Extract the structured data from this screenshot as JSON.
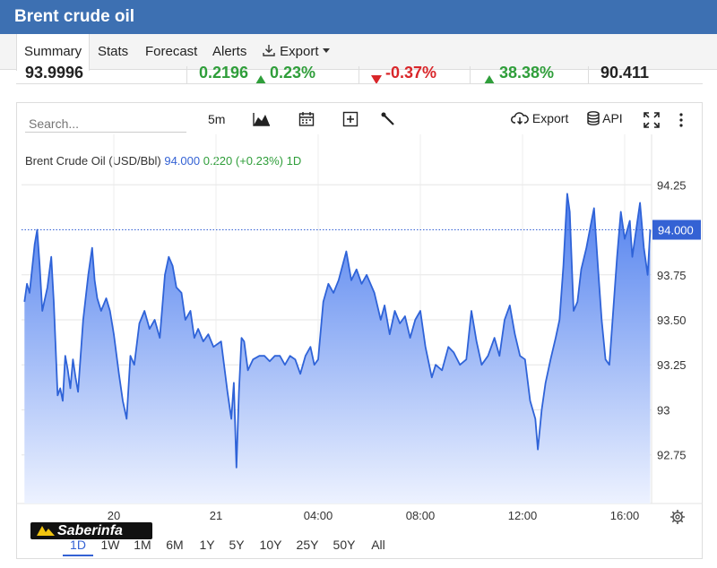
{
  "app": {
    "title": "Brent crude oil"
  },
  "tabs": [
    {
      "label": "Summary",
      "active": true
    },
    {
      "label": "Stats",
      "active": false
    },
    {
      "label": "Forecast",
      "active": false
    },
    {
      "label": "Alerts",
      "active": false
    },
    {
      "label": "Export",
      "active": false
    }
  ],
  "quote_strip": [
    "93.9996",
    "0.2196",
    "0.23%",
    "-0.37%",
    "38.38%",
    "90.411"
  ],
  "toolbar": {
    "search_placeholder": "Search...",
    "interval": "5m",
    "export_label": "Export",
    "api_label": "API"
  },
  "legend": {
    "name": "Brent Crude Oil (USD/Bbl)",
    "price": "94.000",
    "change": "0.220 (+0.23%)",
    "period": "1D"
  },
  "range_buttons": [
    "1D",
    "1W",
    "1M",
    "6M",
    "1Y",
    "5Y",
    "10Y",
    "25Y",
    "50Y",
    "All"
  ],
  "active_range": "1D",
  "watermark": {
    "text": "Saberinfa"
  },
  "colors": {
    "header_bg": "#3d70b2",
    "line": "#2f63d8",
    "area_top": "#4f7fee",
    "area_bottom": "#edf2ff",
    "price_tag": "#3462d4",
    "positive": "#2f9e3a",
    "negative": "#d9262a"
  },
  "chart_data": {
    "type": "area",
    "title": "Brent Crude Oil (USD/Bbl)",
    "ylim": [
      92.48,
      94.53
    ],
    "y_ticks": [
      {
        "value": 92.75,
        "label": "92.75"
      },
      {
        "value": 93.0,
        "label": "93"
      },
      {
        "value": 93.25,
        "label": "93.25"
      },
      {
        "value": 93.5,
        "label": "93.50"
      },
      {
        "value": 93.75,
        "label": "93.75"
      },
      {
        "value": 94.25,
        "label": "94.25"
      }
    ],
    "x_ticks": [
      {
        "label": "20",
        "hour": -4
      },
      {
        "label": "21",
        "hour": 0
      },
      {
        "label": "04:00",
        "hour": 4
      },
      {
        "label": "08:00",
        "hour": 8
      },
      {
        "label": "12:00",
        "hour": 12
      },
      {
        "label": "16:00",
        "hour": 16
      }
    ],
    "x_note": "hours relative to the '21' session marker",
    "last_price": 94.0,
    "last_price_label": "94.000",
    "grid": true,
    "series": [
      {
        "name": "Brent Crude Oil (USD/Bbl)",
        "points": [
          [
            -7.5,
            93.6
          ],
          [
            -7.4,
            93.7
          ],
          [
            -7.3,
            93.65
          ],
          [
            -7.1,
            93.92
          ],
          [
            -7.0,
            94.0
          ],
          [
            -6.9,
            93.8
          ],
          [
            -6.8,
            93.55
          ],
          [
            -6.6,
            93.68
          ],
          [
            -6.45,
            93.85
          ],
          [
            -6.35,
            93.6
          ],
          [
            -6.2,
            93.08
          ],
          [
            -6.1,
            93.12
          ],
          [
            -6.0,
            93.05
          ],
          [
            -5.9,
            93.3
          ],
          [
            -5.8,
            93.22
          ],
          [
            -5.7,
            93.12
          ],
          [
            -5.6,
            93.28
          ],
          [
            -5.5,
            93.18
          ],
          [
            -5.4,
            93.1
          ],
          [
            -5.2,
            93.5
          ],
          [
            -5.0,
            93.75
          ],
          [
            -4.85,
            93.9
          ],
          [
            -4.75,
            93.72
          ],
          [
            -4.65,
            93.62
          ],
          [
            -4.5,
            93.55
          ],
          [
            -4.3,
            93.62
          ],
          [
            -4.15,
            93.55
          ],
          [
            -4.0,
            93.42
          ],
          [
            -3.8,
            93.2
          ],
          [
            -3.65,
            93.05
          ],
          [
            -3.5,
            92.95
          ],
          [
            -3.35,
            93.3
          ],
          [
            -3.2,
            93.25
          ],
          [
            -3.0,
            93.48
          ],
          [
            -2.8,
            93.55
          ],
          [
            -2.6,
            93.45
          ],
          [
            -2.4,
            93.5
          ],
          [
            -2.2,
            93.4
          ],
          [
            -2.0,
            93.75
          ],
          [
            -1.85,
            93.85
          ],
          [
            -1.7,
            93.8
          ],
          [
            -1.55,
            93.68
          ],
          [
            -1.35,
            93.65
          ],
          [
            -1.2,
            93.5
          ],
          [
            -1.0,
            93.55
          ],
          [
            -0.85,
            93.4
          ],
          [
            -0.7,
            93.45
          ],
          [
            -0.5,
            93.38
          ],
          [
            -0.3,
            93.42
          ],
          [
            -0.1,
            93.35
          ],
          [
            0.2,
            93.38
          ],
          [
            0.45,
            93.1
          ],
          [
            0.6,
            92.95
          ],
          [
            0.7,
            93.15
          ],
          [
            0.8,
            92.68
          ],
          [
            0.9,
            93.1
          ],
          [
            1.0,
            93.4
          ],
          [
            1.1,
            93.38
          ],
          [
            1.25,
            93.22
          ],
          [
            1.45,
            93.28
          ],
          [
            1.7,
            93.3
          ],
          [
            1.9,
            93.3
          ],
          [
            2.1,
            93.27
          ],
          [
            2.3,
            93.3
          ],
          [
            2.5,
            93.3
          ],
          [
            2.7,
            93.25
          ],
          [
            2.9,
            93.3
          ],
          [
            3.1,
            93.28
          ],
          [
            3.3,
            93.2
          ],
          [
            3.5,
            93.3
          ],
          [
            3.7,
            93.35
          ],
          [
            3.85,
            93.25
          ],
          [
            4.0,
            93.28
          ],
          [
            4.2,
            93.6
          ],
          [
            4.4,
            93.7
          ],
          [
            4.6,
            93.65
          ],
          [
            4.8,
            93.72
          ],
          [
            5.1,
            93.88
          ],
          [
            5.3,
            93.72
          ],
          [
            5.5,
            93.78
          ],
          [
            5.7,
            93.7
          ],
          [
            5.9,
            93.75
          ],
          [
            6.2,
            93.65
          ],
          [
            6.45,
            93.5
          ],
          [
            6.6,
            93.58
          ],
          [
            6.8,
            93.42
          ],
          [
            7.0,
            93.55
          ],
          [
            7.2,
            93.48
          ],
          [
            7.4,
            93.52
          ],
          [
            7.6,
            93.4
          ],
          [
            7.8,
            93.5
          ],
          [
            8.0,
            93.55
          ],
          [
            8.2,
            93.35
          ],
          [
            8.45,
            93.18
          ],
          [
            8.6,
            93.25
          ],
          [
            8.85,
            93.22
          ],
          [
            9.1,
            93.35
          ],
          [
            9.3,
            93.32
          ],
          [
            9.55,
            93.25
          ],
          [
            9.8,
            93.28
          ],
          [
            10.0,
            93.55
          ],
          [
            10.2,
            93.38
          ],
          [
            10.4,
            93.25
          ],
          [
            10.65,
            93.3
          ],
          [
            10.9,
            93.4
          ],
          [
            11.1,
            93.3
          ],
          [
            11.3,
            93.5
          ],
          [
            11.5,
            93.58
          ],
          [
            11.7,
            93.42
          ],
          [
            11.9,
            93.3
          ],
          [
            12.1,
            93.28
          ],
          [
            12.3,
            93.05
          ],
          [
            12.5,
            92.95
          ],
          [
            12.6,
            92.78
          ],
          [
            12.75,
            93.0
          ],
          [
            12.9,
            93.15
          ],
          [
            13.1,
            93.28
          ],
          [
            13.3,
            93.4
          ],
          [
            13.45,
            93.5
          ],
          [
            13.6,
            93.8
          ],
          [
            13.75,
            94.2
          ],
          [
            13.85,
            94.1
          ],
          [
            14.0,
            93.55
          ],
          [
            14.15,
            93.6
          ],
          [
            14.3,
            93.78
          ],
          [
            14.5,
            93.9
          ],
          [
            14.7,
            94.05
          ],
          [
            14.8,
            94.12
          ],
          [
            14.95,
            93.8
          ],
          [
            15.1,
            93.5
          ],
          [
            15.25,
            93.28
          ],
          [
            15.4,
            93.25
          ],
          [
            15.55,
            93.55
          ],
          [
            15.7,
            93.85
          ],
          [
            15.85,
            94.1
          ],
          [
            16.0,
            93.95
          ],
          [
            16.1,
            94.0
          ],
          [
            16.2,
            94.05
          ],
          [
            16.3,
            93.85
          ],
          [
            16.45,
            94.0
          ],
          [
            16.6,
            94.15
          ],
          [
            16.75,
            93.9
          ],
          [
            16.9,
            93.75
          ],
          [
            17.0,
            94.0
          ]
        ]
      }
    ]
  }
}
